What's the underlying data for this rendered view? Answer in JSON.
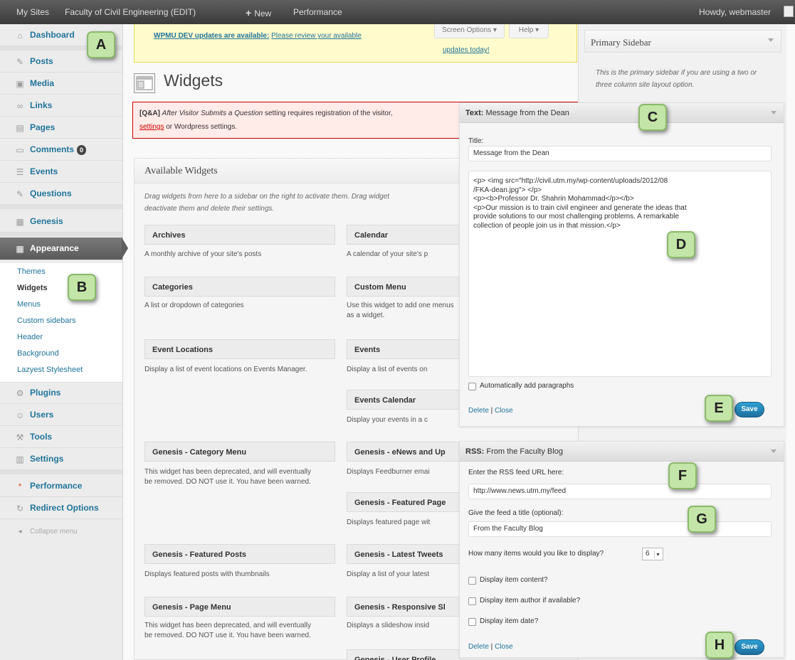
{
  "admin_bar": {
    "my_sites": "My Sites",
    "site_name": "Faculty of Civil Engineering (EDIT)",
    "new": "New",
    "performance": "Performance",
    "howdy": "Howdy, webmaster"
  },
  "sidebar": {
    "items": [
      {
        "label": "Dashboard",
        "icon": "home-icon"
      },
      {
        "label": "Posts",
        "icon": "pin-icon"
      },
      {
        "label": "Media",
        "icon": "media-icon"
      },
      {
        "label": "Links",
        "icon": "link-icon"
      },
      {
        "label": "Pages",
        "icon": "page-icon"
      },
      {
        "label": "Comments",
        "icon": "comment-icon",
        "badge": "0"
      },
      {
        "label": "Events",
        "icon": "events-icon"
      },
      {
        "label": "Questions",
        "icon": "question-icon"
      },
      {
        "label": "Genesis",
        "icon": "genesis-icon"
      },
      {
        "label": "Appearance",
        "icon": "appearance-icon"
      },
      {
        "label": "Plugins",
        "icon": "plugin-icon"
      },
      {
        "label": "Users",
        "icon": "users-icon"
      },
      {
        "label": "Tools",
        "icon": "tools-icon"
      },
      {
        "label": "Settings",
        "icon": "settings-icon"
      },
      {
        "label": "Performance",
        "icon": "performance-icon"
      },
      {
        "label": "Redirect Options",
        "icon": "redirect-icon"
      }
    ],
    "submenu": [
      "Themes",
      "Widgets",
      "Menus",
      "Custom sidebars",
      "Header",
      "Background",
      "Lazyest Stylesheet"
    ],
    "collapse": "Collapse menu"
  },
  "tags": {
    "a": "A",
    "b": "B",
    "c": "C",
    "d": "D",
    "e": "E",
    "f": "F",
    "g": "G",
    "h": "H"
  },
  "notice": {
    "link1": "WPMU DEV updates are available:",
    "link2": "Please review your available",
    "link3": "updates today!",
    "screen_options": "Screen Options",
    "help": "Help"
  },
  "page_title": "Widgets",
  "error": {
    "prefix": "[Q&A]",
    "italic": "After Visitor Submits a Question",
    "rest": "setting requires registration of the visitor,",
    "link": "settings",
    "tail": "or Wordpress settings."
  },
  "available": {
    "title": "Available Widgets",
    "desc_line1": "Drag widgets from here to a sidebar on the right to activate them. Drag widget",
    "desc_line2": "deactivate them and delete their settings.",
    "widgets_left": [
      {
        "title": "Archives",
        "desc": "A monthly archive of your site's posts"
      },
      {
        "title": "Categories",
        "desc": "A list or dropdown of categories"
      },
      {
        "title": "Event Locations",
        "desc": "Display a list of event locations on Events Manager."
      },
      {
        "title": "Genesis - Category Menu",
        "desc": "This widget has been deprecated, and will eventually be removed. DO NOT use it. You have been warned."
      },
      {
        "title": "Genesis - Featured Posts",
        "desc": "Displays featured posts with thumbnails"
      },
      {
        "title": "Genesis - Page Menu",
        "desc": "This widget has been deprecated, and will eventually be removed. DO NOT use it. You have been warned."
      }
    ],
    "widgets_right": [
      {
        "title": "Calendar",
        "desc": "A calendar of your site's p"
      },
      {
        "title": "Custom Menu",
        "desc": "Use this widget to add one menus as a widget."
      },
      {
        "title": "Events",
        "desc": "Display a list of events on"
      },
      {
        "title": "Events Calendar",
        "desc": "Display your events in a c"
      },
      {
        "title": "Genesis - eNews and Up",
        "desc": "Displays Feedburner emai"
      },
      {
        "title": "Genesis - Featured Page",
        "desc": "Displays featured page wit"
      },
      {
        "title": "Genesis - Latest Tweets",
        "desc": "Display a list of your latest"
      },
      {
        "title": "Genesis - Responsive Sl",
        "desc": "Displays a slideshow insid"
      },
      {
        "title": "Genesis - User Profile",
        "desc": ""
      }
    ]
  },
  "primary_sidebar": {
    "title": "Primary Sidebar",
    "desc": "This is the primary sidebar if you are using a two or three column site layout option."
  },
  "text_widget": {
    "head_type": "Text:",
    "head_title": "Message from the Dean",
    "title_label": "Title:",
    "title_value": "Message from the Dean",
    "content": "<p> <img src=\"http://civil.utm.my/wp-content/uploads/2012/08\n/FKA-dean.jpg\"> </p>\n<p><b>Professor Dr. Shahrin Mohammad</p></b>\n<p>Our mission is to train civil engineer and generate the ideas that\nprovide solutions to our most challenging problems. A remarkable\ncollection of people join us in that mission.</p>",
    "auto_para": "Automatically add paragraphs",
    "delete": "Delete",
    "sep": " | ",
    "close": "Close",
    "save": "Save"
  },
  "rss_widget": {
    "head_type": "RSS:",
    "head_title": "From the Faculty Blog",
    "url_label": "Enter the RSS feed URL here:",
    "url_value": "http://www.news.utm.my/feed",
    "title_label": "Give the feed a title (optional):",
    "title_value": "From the Faculty Blog",
    "items_label": "How many items would you like to display?",
    "items_value": "6",
    "opt1": "Display item content?",
    "opt2": "Display item author if available?",
    "opt3": "Display item date?",
    "delete": "Delete",
    "sep": " | ",
    "close": "Close",
    "save": "Save"
  }
}
